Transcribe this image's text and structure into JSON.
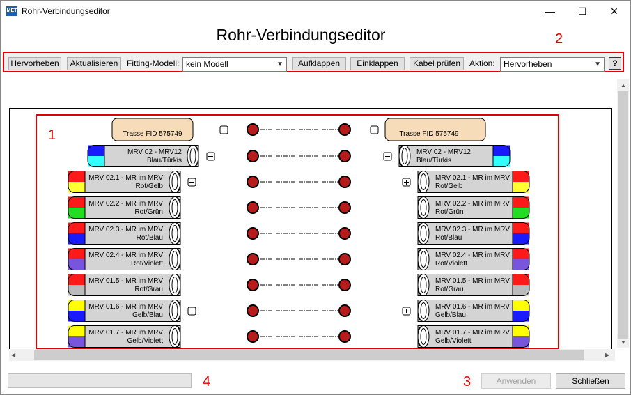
{
  "window": {
    "title": "Rohr-Verbindungseditor",
    "minimize": "—",
    "maximize": "☐",
    "close": "✕"
  },
  "heading": "Rohr-Verbindungseditor",
  "toolbar": {
    "highlight_button": "Hervorheben",
    "refresh_button": "Aktualisieren",
    "fitting_model_label": "Fitting-Modell:",
    "fitting_model_value": "kein Modell",
    "expand_button": "Aufklappen",
    "collapse_button": "Einklappen",
    "check_cable_button": "Kabel prüfen",
    "action_label": "Aktion:",
    "action_value": "Hervorheben",
    "help_button": "?"
  },
  "markers": {
    "m1": "1",
    "m2": "2",
    "m3": "3",
    "m4": "4"
  },
  "connection_colors": {
    "accent_red": "#e00000",
    "connector_fill": "#b71c1c",
    "trasse_fill": "#f6dcb8"
  },
  "rows": [
    {
      "type": "trasse",
      "label": "Trasse FID 575749",
      "toggle": "-"
    },
    {
      "type": "tube",
      "label1": "MRV 02 - MRV12",
      "label2": "Blau/Türkis",
      "toggle": "-",
      "c1": "#1a1aff",
      "c2": "#33ffff"
    },
    {
      "type": "tube",
      "label1": "MRV 02.1 - MR im MRV",
      "label2": "Rot/Gelb",
      "toggle": "+",
      "c1": "#ff1a1a",
      "c2": "#ffff33"
    },
    {
      "type": "tube",
      "label1": "MRV 02.2 - MR im MRV",
      "label2": "Rot/Grün",
      "toggle": "",
      "c1": "#ff1a1a",
      "c2": "#22dd22"
    },
    {
      "type": "tube",
      "label1": "MRV 02.3 - MR im MRV",
      "label2": "Rot/Blau",
      "toggle": "",
      "c1": "#ff1a1a",
      "c2": "#1a1aff"
    },
    {
      "type": "tube",
      "label1": "MRV 02.4 - MR im MRV",
      "label2": "Rot/Violett",
      "toggle": "",
      "c1": "#ff1a1a",
      "c2": "#7755dd"
    },
    {
      "type": "tube",
      "label1": "MRV 01.5 - MR im MRV",
      "label2": "Rot/Grau",
      "toggle": "",
      "c1": "#ff1a1a",
      "c2": "#bbbbbb"
    },
    {
      "type": "tube",
      "label1": "MRV 01.6 - MR im MRV",
      "label2": "Gelb/Blau",
      "toggle": "+",
      "c1": "#ffff00",
      "c2": "#1a1aff"
    },
    {
      "type": "tube",
      "label1": "MRV 01.7 - MR im MRV",
      "label2": "Gelb/Violett",
      "toggle": "",
      "c1": "#ffff00",
      "c2": "#7755dd"
    }
  ],
  "footer": {
    "apply_button": "Anwenden",
    "close_button": "Schließen"
  }
}
